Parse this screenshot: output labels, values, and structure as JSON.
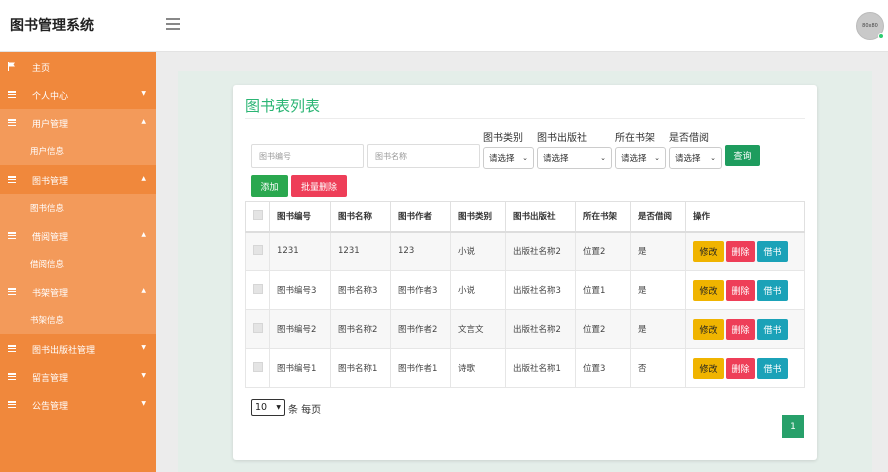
{
  "app": {
    "title": "图书管理系统",
    "avatar_text": "80x80"
  },
  "sidebar": {
    "items": [
      {
        "label": "主页"
      },
      {
        "label": "个人中心"
      },
      {
        "label": "用户管理"
      },
      {
        "label": "用户信息"
      },
      {
        "label": "图书管理"
      },
      {
        "label": "图书信息"
      },
      {
        "label": "借阅管理"
      },
      {
        "label": "借阅信息"
      },
      {
        "label": "书架管理"
      },
      {
        "label": "书架信息"
      },
      {
        "label": "图书出版社管理"
      },
      {
        "label": "留言管理"
      },
      {
        "label": "公告管理"
      }
    ]
  },
  "main": {
    "title": "图书表列表",
    "filters": {
      "book_no_placeholder": "图书编号",
      "book_name_placeholder": "图书名称",
      "category_label": "图书类别",
      "publisher_label": "图书出版社",
      "shelf_label": "所在书架",
      "borrowed_label": "是否借阅",
      "select_default": "请选择",
      "search_label": "查询"
    },
    "buttons": {
      "add": "添加",
      "batch_delete": "批量删除"
    },
    "table": {
      "headers": [
        "图书编号",
        "图书名称",
        "图书作者",
        "图书类别",
        "图书出版社",
        "所在书架",
        "是否借阅",
        "操作"
      ],
      "rows": [
        [
          "1231",
          "1231",
          "123",
          "小说",
          "出版社名称2",
          "位置2",
          "是"
        ],
        [
          "图书编号3",
          "图书名称3",
          "图书作者3",
          "小说",
          "出版社名称3",
          "位置1",
          "是"
        ],
        [
          "图书编号2",
          "图书名称2",
          "图书作者2",
          "文言文",
          "出版社名称2",
          "位置2",
          "是"
        ],
        [
          "图书编号1",
          "图书名称1",
          "图书作者1",
          "诗歌",
          "出版社名称1",
          "位置3",
          "否"
        ]
      ],
      "actions": {
        "edit": "修改",
        "delete": "删除",
        "borrow": "借书"
      }
    },
    "pagination": {
      "page_size": "10",
      "page_size_label": "条 每页",
      "current_page": "1"
    }
  },
  "colors": {
    "sidebar": "#f0883c",
    "accent_green": "#2bb574",
    "danger": "#ee3e58",
    "warning": "#f0b400",
    "info": "#1ba2b8"
  }
}
